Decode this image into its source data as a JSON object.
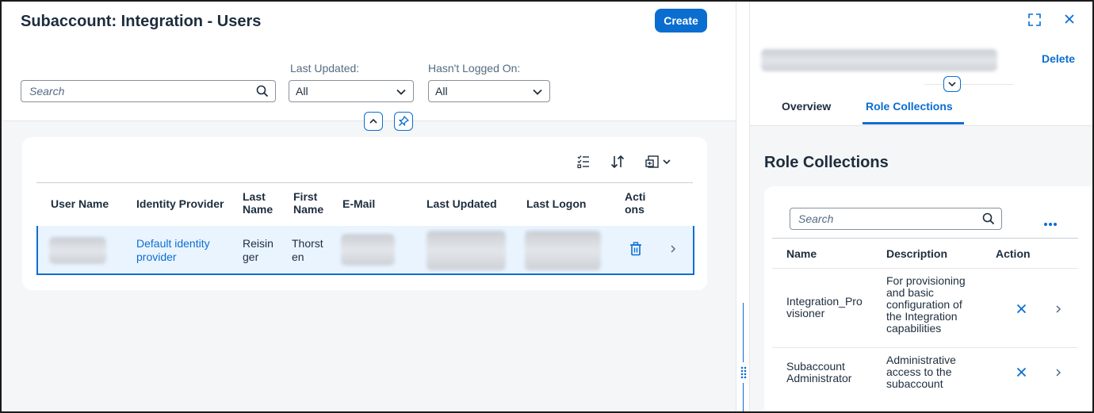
{
  "left": {
    "title": "Subaccount: Integration - Users",
    "create_label": "Create",
    "filters": {
      "search_placeholder": "Search",
      "last_updated_label": "Last Updated:",
      "last_updated_value": "All",
      "logged_on_label": "Hasn't Logged On:",
      "logged_on_value": "All"
    },
    "table": {
      "columns": [
        "User Name",
        "Identity Provider",
        "Last Name",
        "First Name",
        "E-Mail",
        "Last Updated",
        "Last Logon",
        "Actions"
      ],
      "col_lines": {
        "last_name": [
          "Last",
          "Name"
        ],
        "first_name": [
          "First",
          "Name"
        ],
        "actions": [
          "Acti",
          "ons"
        ]
      },
      "rows": [
        {
          "identity_provider": [
            "Default identity",
            "provider"
          ],
          "last_name": [
            "Reisin",
            "ger"
          ],
          "first_name": [
            "Thorst",
            "en"
          ]
        }
      ]
    }
  },
  "right": {
    "delete_label": "Delete",
    "tabs": [
      {
        "label": "Overview",
        "selected": false
      },
      {
        "label": "Role Collections",
        "selected": true
      }
    ],
    "section_title": "Role Collections",
    "search_placeholder": "Search",
    "columns": [
      "Name",
      "Description",
      "Action"
    ],
    "rows": [
      {
        "name": [
          "Integration_Pro",
          "visioner"
        ],
        "description": [
          "For provisioning",
          "and basic",
          "configuration of",
          "the Integration",
          "capabilities"
        ]
      },
      {
        "name": [
          "Subaccount",
          "Administrator"
        ],
        "description": [
          "Administrative",
          "access to the",
          "subaccount"
        ]
      }
    ]
  },
  "colors": {
    "accent": "#0a6ed1",
    "text": "#1d2d3e",
    "background": "#f5f6f7"
  }
}
